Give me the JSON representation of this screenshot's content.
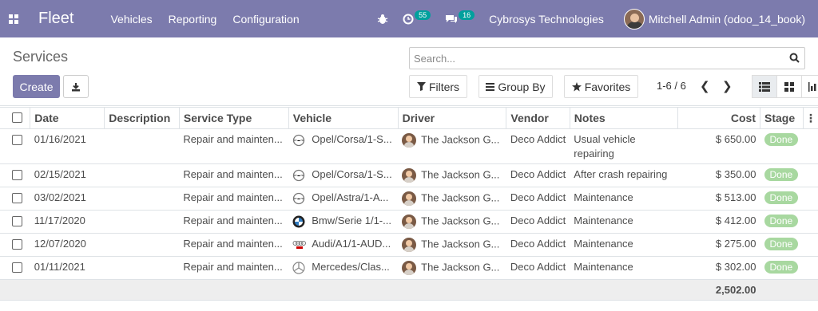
{
  "navbar": {
    "brand": "Fleet",
    "menu": [
      "Vehicles",
      "Reporting",
      "Configuration"
    ],
    "activity_count": "55",
    "message_count": "16",
    "company": "Cybrosys Technologies",
    "user": "Mitchell Admin (odoo_14_book)"
  },
  "control": {
    "breadcrumb": "Services",
    "search_placeholder": "Search...",
    "create_label": "Create",
    "filters_label": "Filters",
    "groupby_label": "Group By",
    "favorites_label": "Favorites",
    "pager": "1-6 / 6"
  },
  "table": {
    "headers": [
      "Date",
      "Description",
      "Service Type",
      "Vehicle",
      "Driver",
      "Vendor",
      "Notes",
      "Cost",
      "Stage"
    ],
    "rows": [
      {
        "date": "01/16/2021",
        "description": "",
        "service_type": "Repair and mainten...",
        "vehicle": "Opel/Corsa/1-S...",
        "vehicle_logo": "opel-logo-icon",
        "driver": "The Jackson G...",
        "vendor": "Deco Addict",
        "notes": "Usual vehicle",
        "notes2": "repairing",
        "cost": "$ 650.00",
        "stage": "Done"
      },
      {
        "date": "02/15/2021",
        "description": "",
        "service_type": "Repair and mainten...",
        "vehicle": "Opel/Corsa/1-S...",
        "vehicle_logo": "opel-logo-icon",
        "driver": "The Jackson G...",
        "vendor": "Deco Addict",
        "notes": "After crash repairing",
        "notes2": "",
        "cost": "$ 350.00",
        "stage": "Done"
      },
      {
        "date": "03/02/2021",
        "description": "",
        "service_type": "Repair and mainten...",
        "vehicle": "Opel/Astra/1-A...",
        "vehicle_logo": "opel-logo-icon",
        "driver": "The Jackson G...",
        "vendor": "Deco Addict",
        "notes": "Maintenance",
        "notes2": "",
        "cost": "$ 513.00",
        "stage": "Done"
      },
      {
        "date": "11/17/2020",
        "description": "",
        "service_type": "Repair and mainten...",
        "vehicle": "Bmw/Serie 1/1-...",
        "vehicle_logo": "bmw-logo-icon",
        "driver": "The Jackson G...",
        "vendor": "Deco Addict",
        "notes": "Maintenance",
        "notes2": "",
        "cost": "$ 412.00",
        "stage": "Done"
      },
      {
        "date": "12/07/2020",
        "description": "",
        "service_type": "Repair and mainten...",
        "vehicle": "Audi/A1/1-AUD...",
        "vehicle_logo": "audi-logo-icon",
        "driver": "The Jackson G...",
        "vendor": "Deco Addict",
        "notes": "Maintenance",
        "notes2": "",
        "cost": "$ 275.00",
        "stage": "Done"
      },
      {
        "date": "01/11/2021",
        "description": "",
        "service_type": "Repair and mainten...",
        "vehicle": "Mercedes/Clas...",
        "vehicle_logo": "mercedes-logo-icon",
        "driver": "The Jackson G...",
        "vendor": "Deco Addict",
        "notes": "Maintenance",
        "notes2": "",
        "cost": "$ 302.00",
        "stage": "Done"
      }
    ],
    "total_cost": "2,502.00"
  }
}
